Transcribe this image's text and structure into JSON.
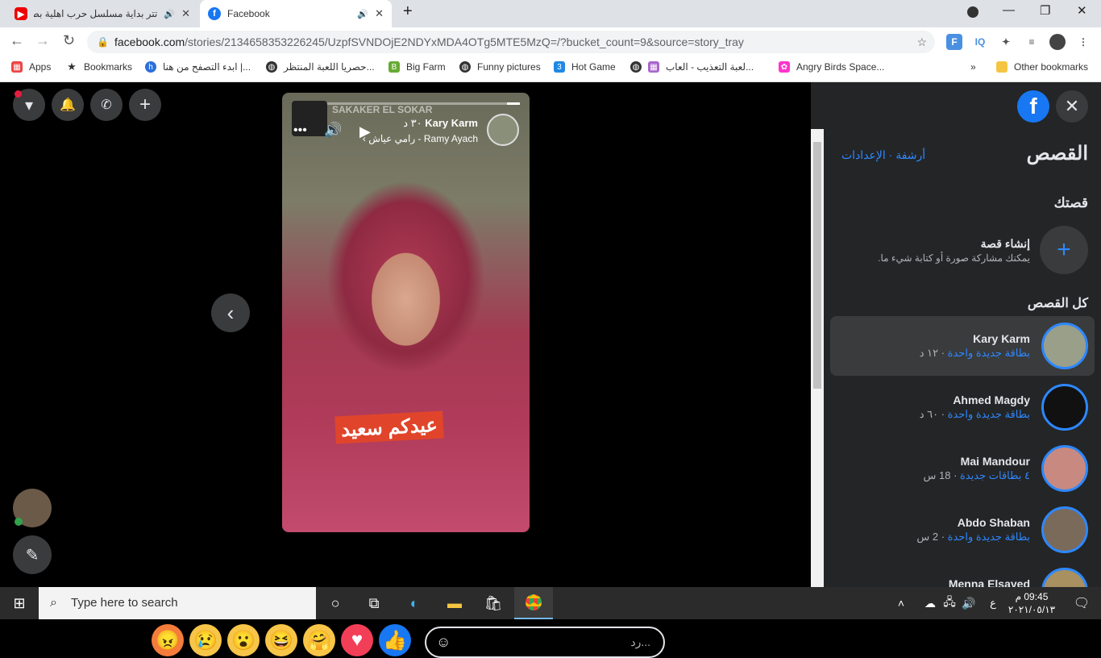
{
  "browser": {
    "tabs": [
      {
        "title": "تتر بداية مسلسل حرب اهلية بطـ",
        "favicon": "youtube-icon"
      },
      {
        "title": "Facebook",
        "favicon": "facebook-icon"
      }
    ],
    "url_domain": "facebook.com",
    "url_path": "/stories/2134658353226245/UzpfSVNDOjE2NDYxMDA4OTg5MTE5MzQ=/?bucket_count=9&source=story_tray",
    "bookmarks": [
      "Apps",
      "Bookmarks",
      "ابدء التصفح من هنا |...",
      "حصريا اللعبة المنتظر...",
      "Big Farm",
      "Funny pictures",
      "Hot Game",
      "لعبة التعذيب - العاب...",
      "Angry Birds Space...",
      "Other bookmarks"
    ]
  },
  "story": {
    "author": "Kary Karm",
    "time": "٣٠ د",
    "song": "رامي عياش - Ramy Ayach",
    "music_label": "SAKAKER EL SOKAR",
    "caption": "عيدكم سعيد",
    "reply_placeholder": "رد..."
  },
  "sidebar": {
    "title": "القصص",
    "links": "أرشفة · الإعدادات",
    "your_story_label": "قصتك",
    "create_title": "إنشاء قصة",
    "create_sub": "يمكنك مشاركة صورة أو كتابة شيء ما.",
    "all_stories_label": "كل القصص",
    "people": [
      {
        "name": "Kary Karm",
        "new": "بطاقة جديدة واحدة",
        "time": "١٢ د"
      },
      {
        "name": "Ahmed Magdy",
        "new": "بطاقة جديدة واحدة",
        "time": "٦٠ د"
      },
      {
        "name": "Mai Mandour",
        "new": "٤ بطاقات جديدة",
        "time": "18 س"
      },
      {
        "name": "Abdo Shaban",
        "new": "بطاقة جديدة واحدة",
        "time": "2 س"
      },
      {
        "name": "Menna Elsayed",
        "new": "",
        "time": ""
      }
    ]
  },
  "taskbar": {
    "search_placeholder": "Type here to search",
    "lang": "ع",
    "time": "09:45 م",
    "date": "٢٠٢١/٠٥/١٣"
  },
  "colors": {
    "accent": "#2d88ff",
    "fb_blue": "#1877f2"
  }
}
